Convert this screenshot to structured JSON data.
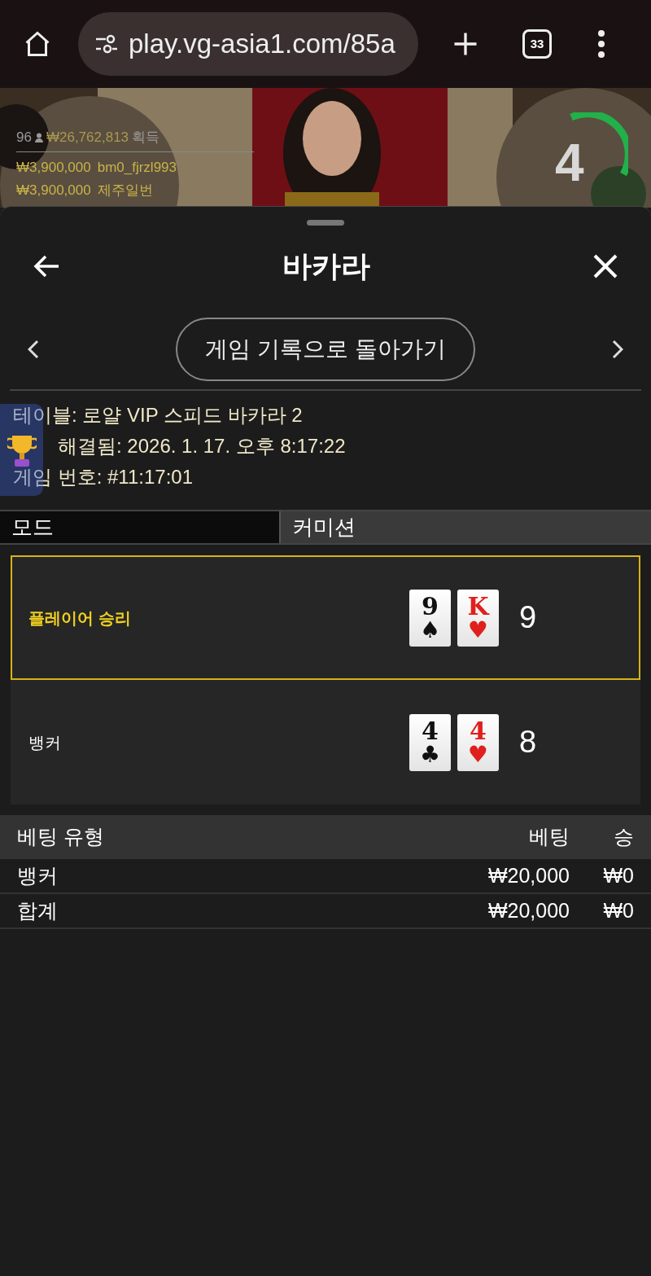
{
  "browser": {
    "url": "play.vg-asia1.com/85a",
    "tab_count": "33"
  },
  "video": {
    "players_count": "96",
    "total_won": "₩26,762,813",
    "won_label": "획득",
    "winners": [
      {
        "amount": "₩3,900,000",
        "name": "bm0_fjrzl993"
      },
      {
        "amount": "₩3,900,000",
        "name": "제주일번"
      }
    ],
    "timer": "4"
  },
  "sheet": {
    "title": "바카라",
    "back_to_history": "게임 기록으로 돌아가기",
    "info": [
      {
        "kind": "full",
        "text": "테이블: 로얄 VIP 스피드 바카라 2"
      },
      {
        "kind": "covered",
        "text": "해결됨: 2026. 1. 17. 오후 8:17:22"
      },
      {
        "kind": "full",
        "text": "게임 번호: #11:17:01"
      }
    ],
    "mode_row": {
      "label": "모드",
      "value": "커미션"
    },
    "results": [
      {
        "label": "플레이어 승리",
        "winner": true,
        "score": "9",
        "cards": [
          {
            "rank": "9",
            "suit": "♠",
            "color": "#111111"
          },
          {
            "rank": "K",
            "suit": "♥",
            "color": "#e0201c"
          }
        ]
      },
      {
        "label": "뱅커",
        "winner": false,
        "score": "8",
        "cards": [
          {
            "rank": "4",
            "suit": "♣",
            "color": "#111111"
          },
          {
            "rank": "4",
            "suit": "♥",
            "color": "#e0201c"
          }
        ]
      }
    ],
    "bets": {
      "columns": [
        "베팅 유형",
        "베팅",
        "승"
      ],
      "rows": [
        {
          "type": "뱅커",
          "bet": "₩20,000",
          "win": "₩0"
        },
        {
          "type": "합계",
          "bet": "₩20,000",
          "win": "₩0"
        }
      ]
    }
  }
}
